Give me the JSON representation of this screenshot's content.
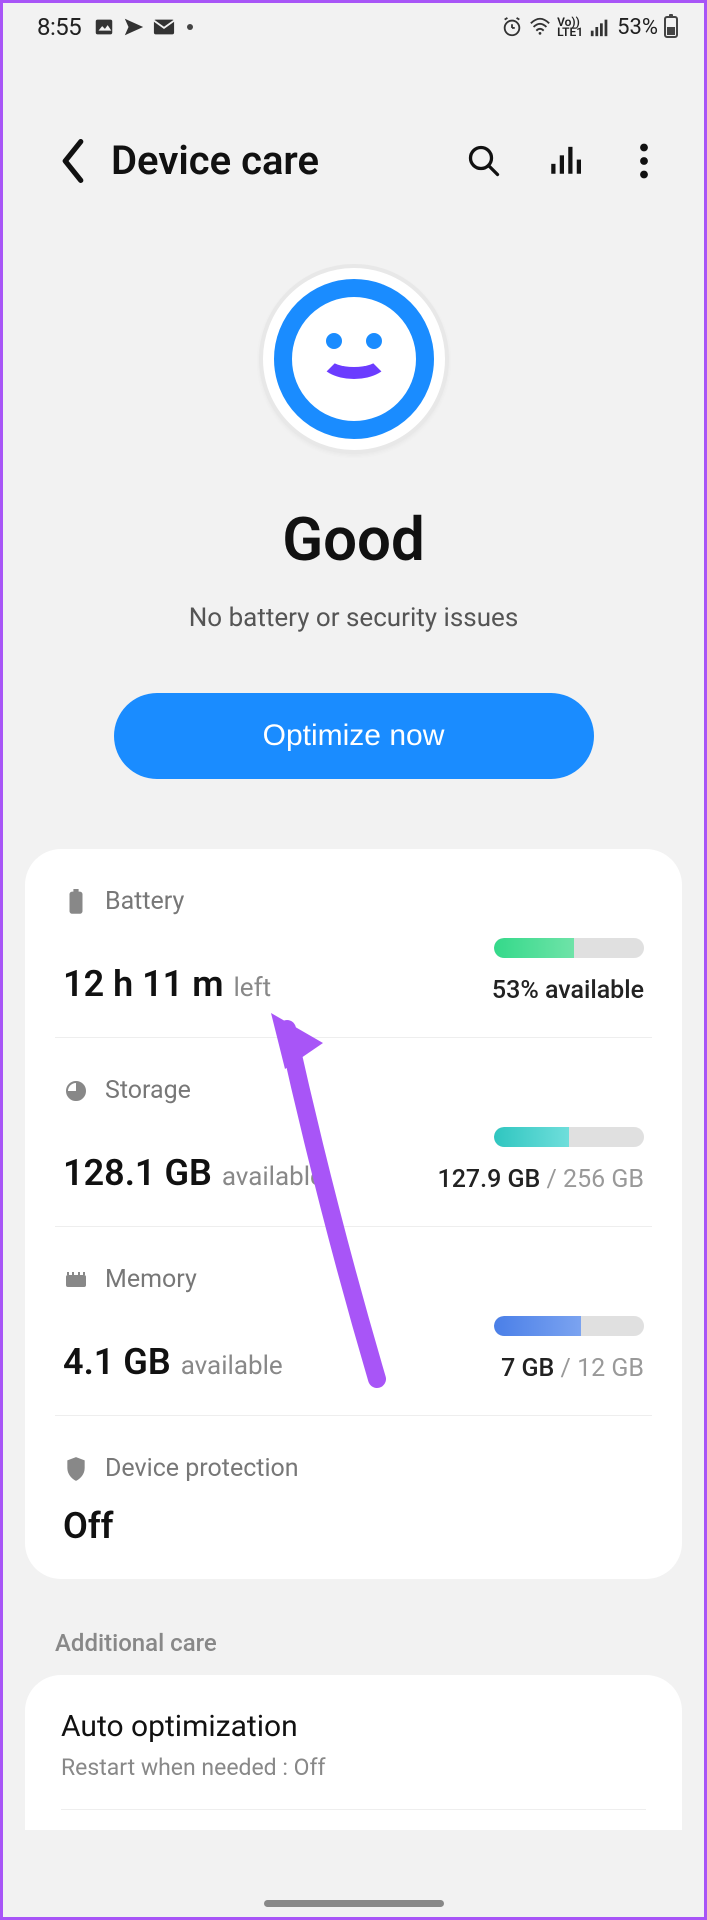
{
  "status": {
    "time": "8:55",
    "battery_percent": "53%",
    "network_label": "LTE1",
    "volte_label": "Vo))"
  },
  "header": {
    "title": "Device care"
  },
  "hero": {
    "status_title": "Good",
    "status_sub": "No battery or security issues",
    "optimize_label": "Optimize now"
  },
  "battery": {
    "label": "Battery",
    "value": "12 h 11 m",
    "suffix": "left",
    "percent_fill": 53,
    "right_text": "53% available"
  },
  "storage": {
    "label": "Storage",
    "value": "128.1 GB",
    "suffix": "available",
    "percent_fill": 50,
    "used": "127.9 GB",
    "total": "256 GB"
  },
  "memory": {
    "label": "Memory",
    "value": "4.1 GB",
    "suffix": "available",
    "percent_fill": 58,
    "used": "7 GB",
    "total": "12 GB"
  },
  "protection": {
    "label": "Device protection",
    "value": "Off"
  },
  "additional": {
    "section_title": "Additional care",
    "auto_opt_title": "Auto optimization",
    "auto_opt_sub": "Restart when needed : Off"
  }
}
